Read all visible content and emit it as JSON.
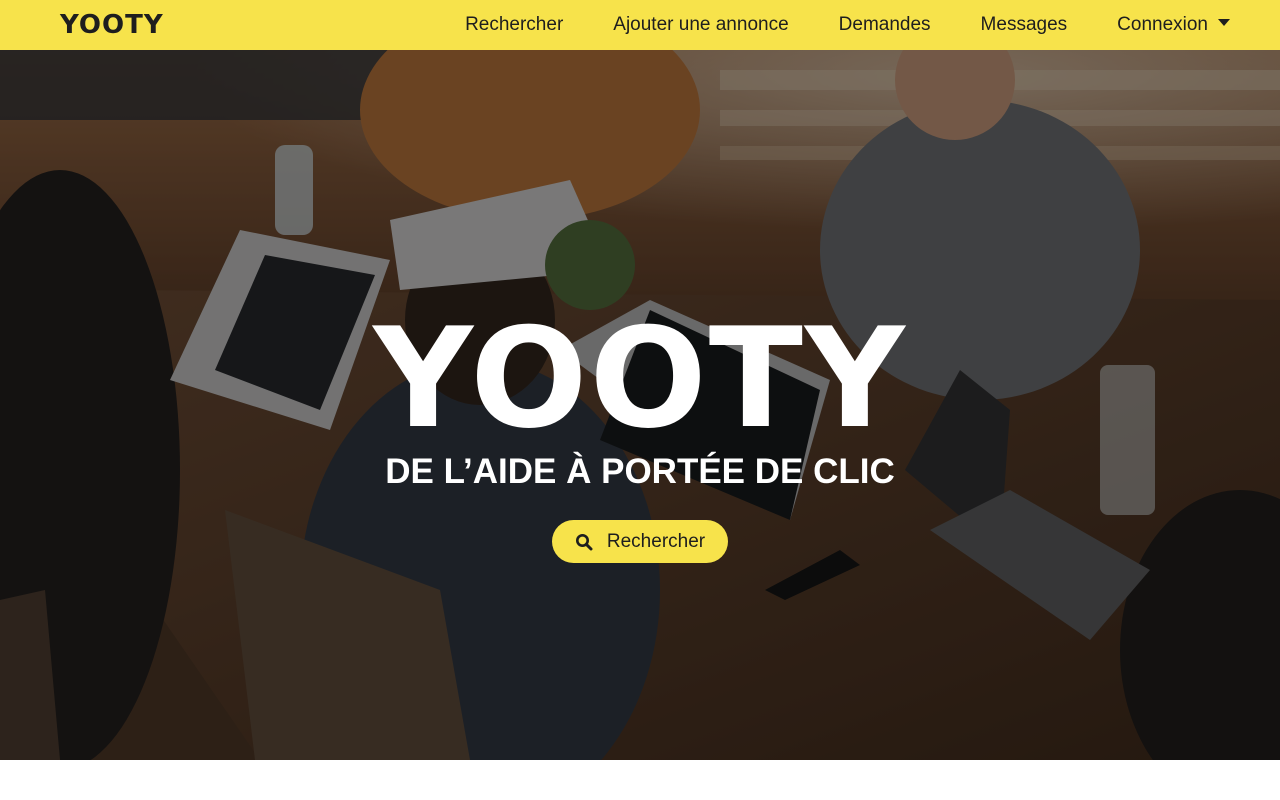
{
  "theme": {
    "accent": "#f7e34b",
    "text_dark": "#1e1e1e",
    "hero_text": "#ffffff"
  },
  "navbar": {
    "brand": "YOOTY",
    "items": [
      {
        "label": "Rechercher"
      },
      {
        "label": "Ajouter une annonce"
      },
      {
        "label": "Demandes"
      },
      {
        "label": "Messages"
      },
      {
        "label": "Connexion",
        "dropdown": true
      }
    ]
  },
  "hero": {
    "title": "YOOTY",
    "subtitle": "DE L’AIDE À PORTÉE DE CLIC",
    "search_button": {
      "label": "Rechercher",
      "icon": "search-icon"
    }
  }
}
